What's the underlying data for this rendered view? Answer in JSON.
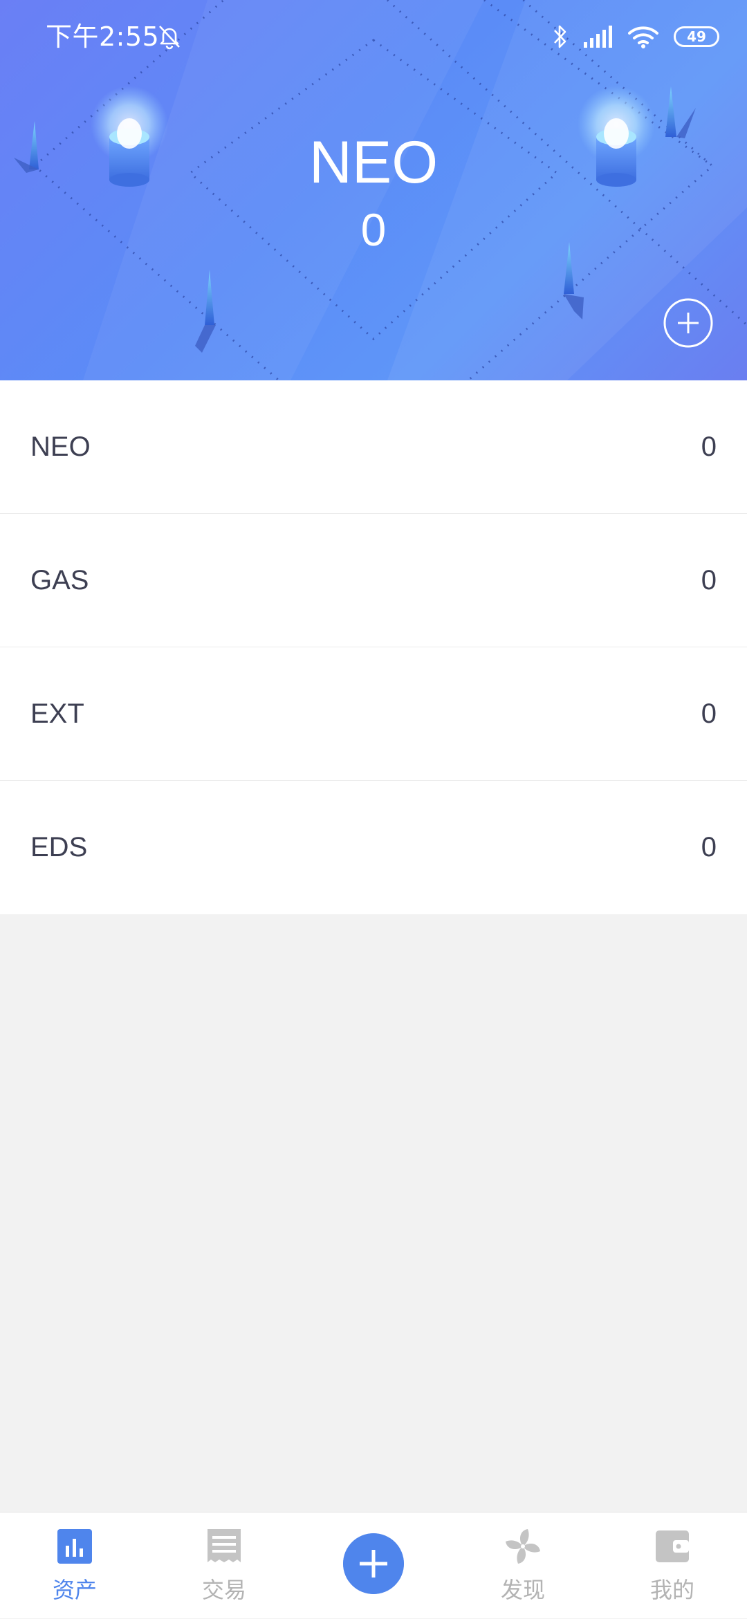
{
  "status_bar": {
    "time": "下午2:55",
    "battery": "49"
  },
  "header": {
    "asset_name": "NEO",
    "asset_total": "0"
  },
  "assets": [
    {
      "name": "NEO",
      "amount": "0"
    },
    {
      "name": "GAS",
      "amount": "0"
    },
    {
      "name": "EXT",
      "amount": "0"
    },
    {
      "name": "EDS",
      "amount": "0"
    }
  ],
  "bottom_nav": {
    "items": [
      {
        "label": "资产",
        "icon": "bar-chart-icon",
        "active": true
      },
      {
        "label": "交易",
        "icon": "receipt-icon",
        "active": false
      },
      {
        "label": "",
        "icon": "plus-icon",
        "active": false
      },
      {
        "label": "发现",
        "icon": "pinwheel-icon",
        "active": false
      },
      {
        "label": "我的",
        "icon": "wallet-icon",
        "active": false
      }
    ]
  },
  "colors": {
    "accent": "#4f85ec",
    "header_gradient_start": "#6a7ff5",
    "header_gradient_end": "#5f96f8",
    "text_primary": "#3d3f52",
    "nav_inactive": "#b3b3b3",
    "page_background": "#f2f2f2"
  }
}
